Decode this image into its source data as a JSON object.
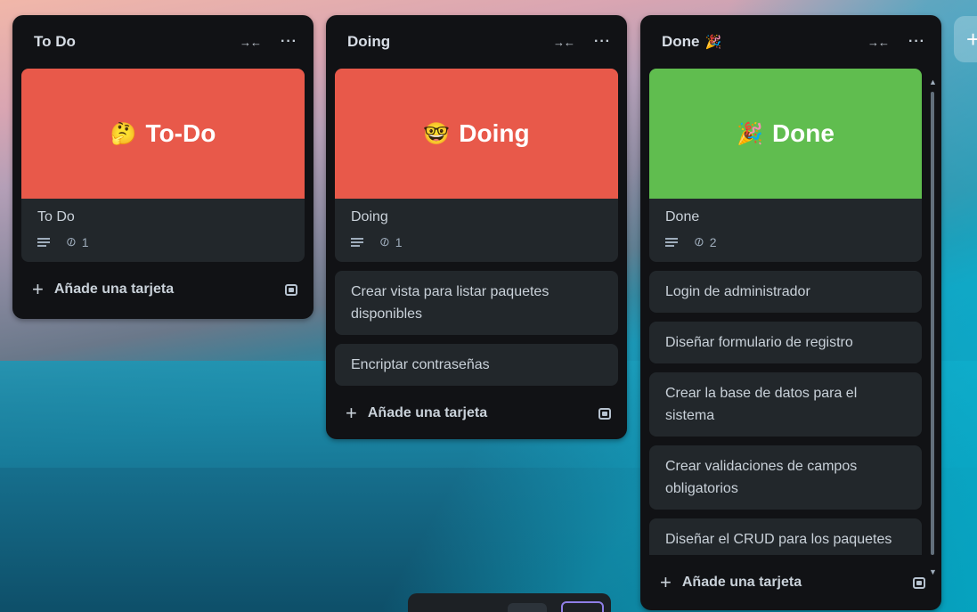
{
  "lists": [
    {
      "title": "To Do",
      "title_emoji": "",
      "cover": {
        "emoji": "🤔",
        "text": "To-Do",
        "color": "#e8594a"
      },
      "cover_card": {
        "title": "To Do",
        "attachments": "1"
      },
      "cards": [],
      "add_label": "Añade una tarjeta"
    },
    {
      "title": "Doing",
      "title_emoji": "",
      "cover": {
        "emoji": "🤓",
        "text": "Doing",
        "color": "#e8594a"
      },
      "cover_card": {
        "title": "Doing",
        "attachments": "1"
      },
      "cards": [
        "Crear vista para listar paquetes disponibles",
        "Encriptar contraseñas"
      ],
      "add_label": "Añade una tarjeta"
    },
    {
      "title": "Done",
      "title_emoji": "🎉",
      "cover": {
        "emoji": "🎉",
        "text": "Done",
        "color": "#60bd4f"
      },
      "cover_card": {
        "title": "Done",
        "attachments": "2"
      },
      "cards": [
        "Login de administrador",
        "Diseñar formulario de registro",
        "Crear la base de datos para el sistema",
        "Crear validaciones de campos obligatorios",
        "Diseñar el CRUD para los paquetes turísticos"
      ],
      "add_label": "Añade una tarjeta"
    }
  ],
  "icons": {
    "collapse": "→←",
    "more": "···",
    "plus": "+",
    "add_list": "+"
  }
}
